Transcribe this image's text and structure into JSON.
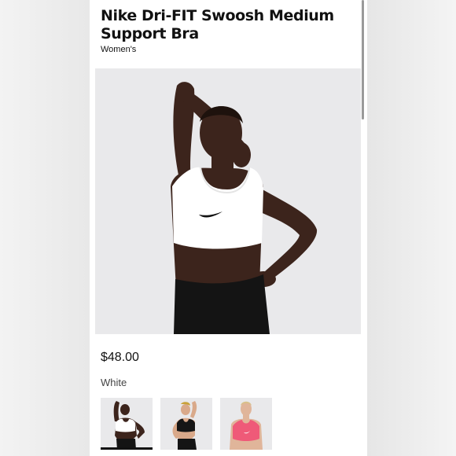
{
  "product": {
    "title": "Nike Dri-FIT Swoosh Medium Support Bra",
    "category": "Women's",
    "price": "$48.00",
    "color_name": "White"
  },
  "thumbnails": [
    {
      "color": "white",
      "selected": true
    },
    {
      "color": "black",
      "selected": false
    },
    {
      "color": "pink",
      "selected": false
    }
  ],
  "colors": {
    "background": "#ececec",
    "panel": "#ffffff",
    "image_bg": "#e9e9eb",
    "text": "#111111",
    "thumb_pink": "#ef5a78"
  }
}
